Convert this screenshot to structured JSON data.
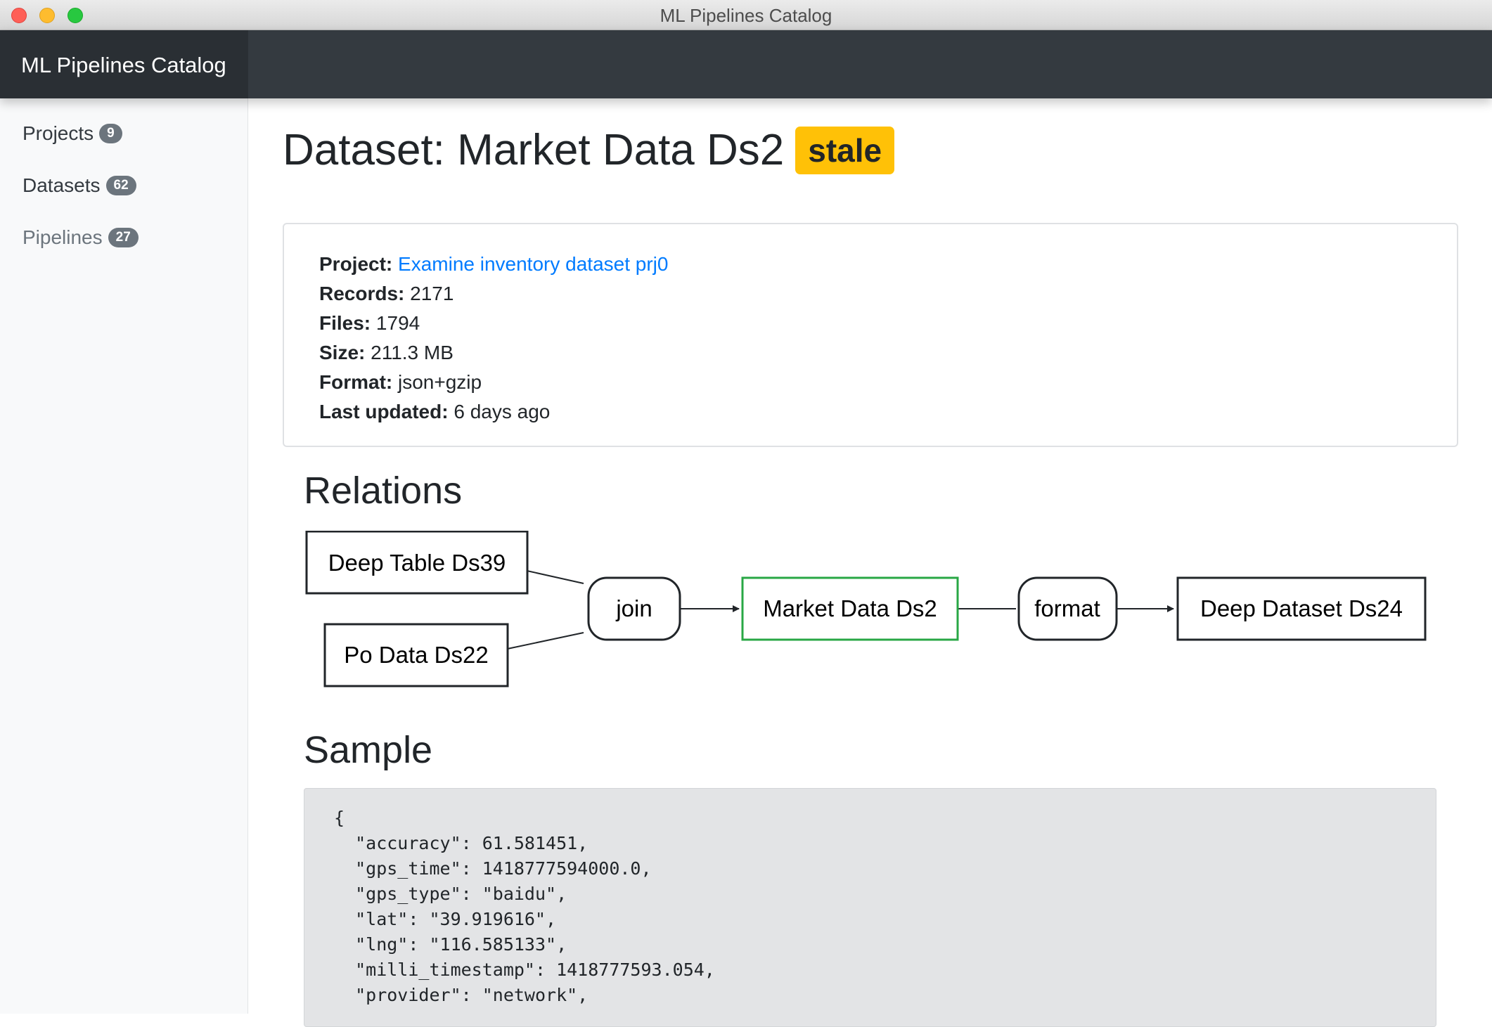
{
  "window": {
    "title": "ML Pipelines Catalog"
  },
  "navbar": {
    "brand": "ML Pipelines Catalog"
  },
  "sidebar": {
    "items": [
      {
        "label": "Projects",
        "count": "9"
      },
      {
        "label": "Datasets",
        "count": "62"
      },
      {
        "label": "Pipelines",
        "count": "27"
      }
    ]
  },
  "dataset": {
    "title": "Dataset: Market Data Ds2",
    "status": "stale",
    "status_color": "#ffc107",
    "fields": [
      {
        "label": "Project:",
        "value": "Examine inventory dataset prj0"
      },
      {
        "label": "Records:",
        "value": "2171"
      },
      {
        "label": "Files:",
        "value": "1794"
      },
      {
        "label": "Size:",
        "value": "211.3 MB"
      },
      {
        "label": "Format:",
        "value": "json+gzip"
      },
      {
        "label": "Last updated:",
        "value": "6 days ago"
      }
    ]
  },
  "relations": {
    "heading": "Relations",
    "nodes": {
      "input1": "Deep Table Ds39",
      "input2": "Po Data Ds22",
      "op1": "join",
      "current": "Market Data Ds2",
      "op2": "format",
      "output": "Deep Dataset Ds24"
    },
    "current_color": "#28a745"
  },
  "sample": {
    "heading": "Sample",
    "lines": [
      "{",
      "  \"accuracy\": 61.581451,",
      "  \"gps_time\": 1418777594000.0,",
      "  \"gps_type\": \"baidu\",",
      "  \"lat\": \"39.919616\",",
      "  \"lng\": \"116.585133\",",
      "  \"milli_timestamp\": 1418777593.054,",
      "  \"provider\": \"network\","
    ]
  }
}
